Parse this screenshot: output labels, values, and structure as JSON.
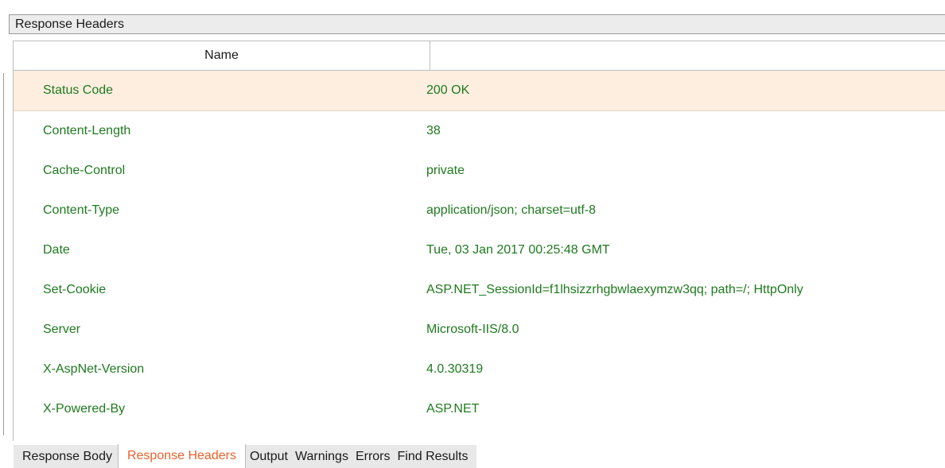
{
  "panel": {
    "title": "Response Headers"
  },
  "grid": {
    "columns": {
      "name": "Name",
      "value": ""
    },
    "rows": [
      {
        "name": "Status Code",
        "value": "200 OK"
      },
      {
        "name": "Content-Length",
        "value": "38"
      },
      {
        "name": "Cache-Control",
        "value": "private"
      },
      {
        "name": "Content-Type",
        "value": "application/json; charset=utf-8"
      },
      {
        "name": "Date",
        "value": "Tue, 03 Jan 2017 00:25:48 GMT"
      },
      {
        "name": "Set-Cookie",
        "value": "ASP.NET_SessionId=f1lhsizzrhgbwlaexymzw3qq; path=/; HttpOnly"
      },
      {
        "name": "Server",
        "value": "Microsoft-IIS/8.0"
      },
      {
        "name": "X-AspNet-Version",
        "value": "4.0.30319"
      },
      {
        "name": "X-Powered-By",
        "value": "ASP.NET"
      }
    ]
  },
  "tabs": [
    {
      "label": "Response Body",
      "active": false
    },
    {
      "label": "Response Headers",
      "active": true
    },
    {
      "label": "Output",
      "active": false
    },
    {
      "label": "Warnings",
      "active": false
    },
    {
      "label": "Errors",
      "active": false
    },
    {
      "label": "Find Results",
      "active": false
    }
  ],
  "colors": {
    "value_text": "#1f7a1f",
    "selected_row_bg": "#fdeee0",
    "active_tab_text": "#e8622c"
  }
}
